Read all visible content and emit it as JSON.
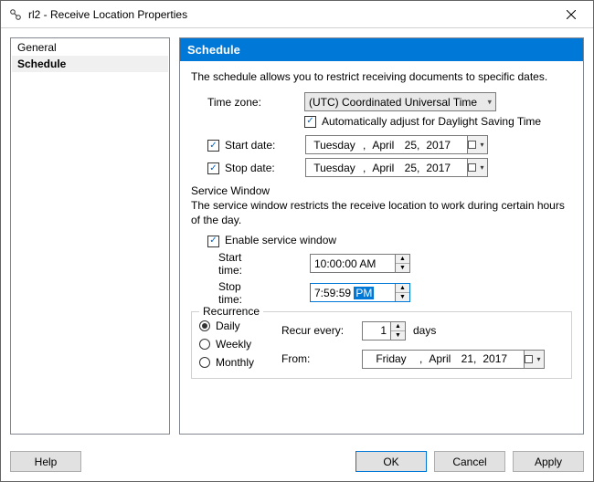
{
  "window": {
    "title": "rl2 - Receive Location Properties"
  },
  "sidebar": {
    "items": [
      {
        "label": "General",
        "selected": false
      },
      {
        "label": "Schedule",
        "selected": true
      }
    ]
  },
  "header": "Schedule",
  "description": "The schedule allows you to restrict receiving documents to specific dates.",
  "timezone": {
    "label": "Time zone:",
    "value": "(UTC) Coordinated Universal Time",
    "auto_dst_label": "Automatically adjust for Daylight Saving Time",
    "auto_dst_checked": true
  },
  "start_date": {
    "label": "Start date:",
    "checked": true,
    "day": "Tuesday",
    "month": "April",
    "dnum": "25,",
    "year": "2017"
  },
  "stop_date": {
    "label": "Stop date:",
    "checked": true,
    "day": "Tuesday",
    "month": "April",
    "dnum": "25,",
    "year": "2017"
  },
  "service_window": {
    "title": "Service Window",
    "desc": "The service window restricts the receive location to work during certain hours of the day.",
    "enable_label": "Enable service window",
    "enable_checked": true,
    "start_label": "Start time:",
    "start_value": "10:00:00 AM",
    "stop_label": "Stop time:",
    "stop_value_prefix": "7:59:59 ",
    "stop_value_hl": "PM"
  },
  "recurrence": {
    "title": "Recurrence",
    "options": [
      "Daily",
      "Weekly",
      "Monthly"
    ],
    "selected": "Daily",
    "recur_label": "Recur every:",
    "recur_value": "1",
    "recur_unit": "days",
    "from_label": "From:",
    "from": {
      "day": "Friday",
      "month": "April",
      "dnum": "21,",
      "year": "2017"
    }
  },
  "footer": {
    "help": "Help",
    "ok": "OK",
    "cancel": "Cancel",
    "apply": "Apply"
  }
}
